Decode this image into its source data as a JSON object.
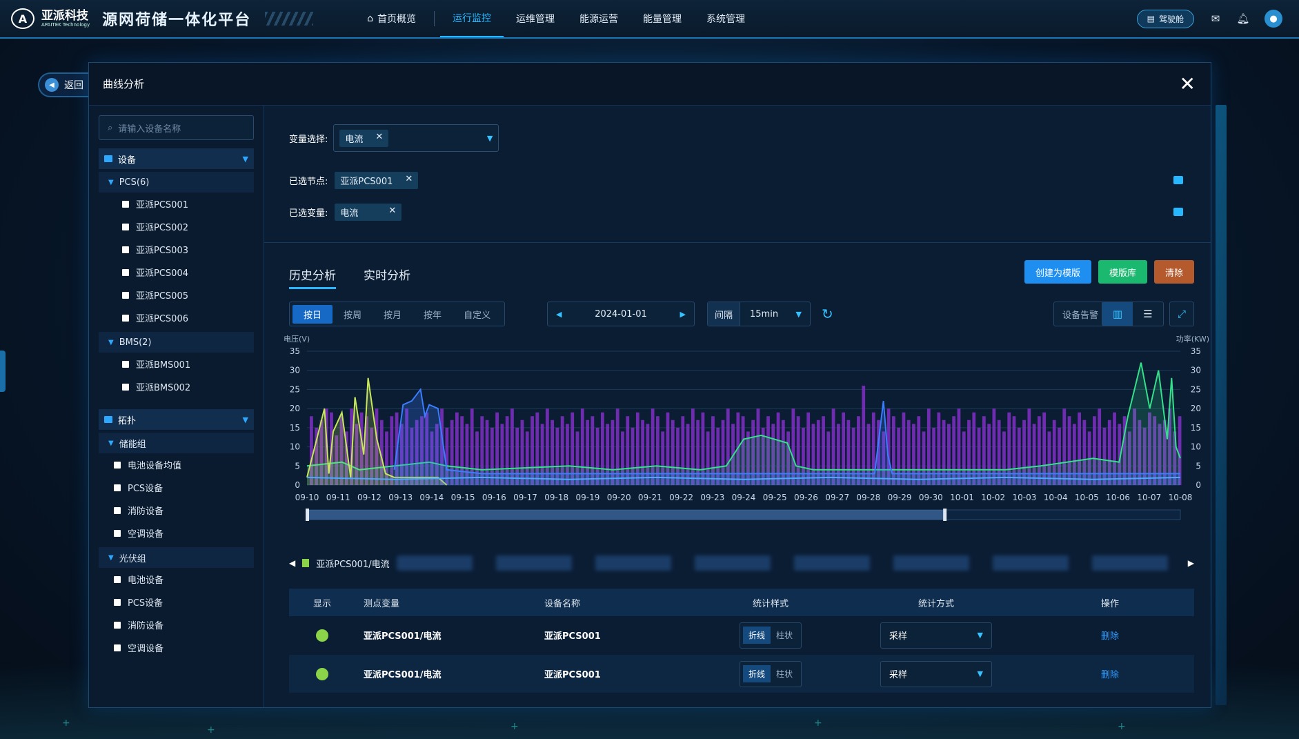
{
  "header": {
    "logo_text": "亚派科技",
    "logo_sub": "APAITEK Technology",
    "app_title": "源网荷储一体化平台",
    "nav": [
      "首页概览",
      "运行监控",
      "运维管理",
      "能源运营",
      "能量管理",
      "系统管理"
    ],
    "nav_active": "运行监控",
    "cockpit_label": "驾驶舱"
  },
  "back_label": "返回",
  "modal": {
    "title": "曲线分析",
    "search_placeholder": "请输入设备名称",
    "tree": {
      "devices_label": "设备",
      "pcs_group": "PCS(6)",
      "pcs_items": [
        "亚派PCS001",
        "亚派PCS002",
        "亚派PCS003",
        "亚派PCS004",
        "亚派PCS005",
        "亚派PCS006"
      ],
      "bms_group": "BMS(2)",
      "bms_items": [
        "亚派BMS001",
        "亚派BMS002"
      ],
      "topology_label": "拓扑",
      "storage_group": "储能组",
      "storage_items": [
        "电池设备均值",
        "PCS设备",
        "消防设备",
        "空调设备"
      ],
      "pv_group": "光伏组",
      "pv_items": [
        "电池设备",
        "PCS设备",
        "消防设备",
        "空调设备"
      ]
    },
    "var_select_label": "变量选择:",
    "var_select_chip": "电流",
    "selected_nodes_label": "已选节点:",
    "selected_node": "亚派PCS001",
    "selected_vars_label": "已选变量:",
    "selected_var": "电流",
    "tabs": [
      "历史分析",
      "实时分析"
    ],
    "buttons": {
      "create_template": "创建为模版",
      "template_lib": "模版库",
      "clear": "清除"
    },
    "period_options": [
      "按日",
      "按周",
      "按月",
      "按年",
      "自定义"
    ],
    "period_active": "按日",
    "date": "2024-01-01",
    "interval_label": "间隔",
    "interval_value": "15min",
    "alarm_label": "设备告警",
    "legend_first": "亚派PCS001/电流",
    "table": {
      "headers": [
        "显示",
        "测点变量",
        "设备名称",
        "统计样式",
        "统计方式",
        "操作"
      ],
      "rows": [
        {
          "var": "亚派PCS001/电流",
          "device": "亚派PCS001",
          "style_line": "折线",
          "style_bar": "柱状",
          "method": "采样",
          "action": "删除"
        },
        {
          "var": "亚派PCS001/电流",
          "device": "亚派PCS001",
          "style_line": "折线",
          "style_bar": "柱状",
          "method": "采样",
          "action": "删除"
        }
      ]
    }
  },
  "chart_data": {
    "type": "bar",
    "ylabel_left": "电压(V)",
    "ylabel_right": "功率(KW)",
    "ylim": [
      0,
      35
    ],
    "yticks": [
      0,
      5,
      10,
      15,
      20,
      25,
      30,
      35
    ],
    "categories": [
      "09-10",
      "09-11",
      "09-12",
      "09-13",
      "09-14",
      "09-15",
      "09-16",
      "09-17",
      "09-18",
      "09-19",
      "09-20",
      "09-21",
      "09-22",
      "09-23",
      "09-24",
      "09-25",
      "09-26",
      "09-27",
      "09-28",
      "09-29",
      "09-30",
      "10-01",
      "10-02",
      "10-03",
      "10-04",
      "10-05",
      "10-06",
      "10-07",
      "10-08"
    ],
    "bar_values": [
      18,
      15,
      17,
      20,
      19,
      13,
      18,
      14,
      20,
      16,
      19,
      18,
      15,
      20,
      17,
      14,
      18,
      19,
      16,
      20,
      15,
      17,
      18,
      19,
      14,
      16,
      20,
      15,
      17,
      19,
      18,
      16,
      20,
      14,
      18,
      17,
      15,
      19,
      16,
      18,
      20,
      15,
      17,
      14,
      18,
      19,
      16,
      20,
      17,
      15,
      18,
      16,
      19,
      14,
      20,
      17,
      18,
      15,
      19,
      16,
      17,
      20,
      14,
      18,
      15,
      19,
      17,
      16,
      20,
      18,
      14,
      19,
      17,
      15,
      18,
      16,
      20,
      17,
      19,
      14,
      18,
      15,
      17,
      20,
      16,
      19,
      18,
      14,
      17,
      20,
      15,
      18,
      16,
      19,
      17,
      14,
      20,
      18,
      15,
      19,
      16,
      17,
      18,
      14,
      20,
      16,
      19,
      17,
      15,
      18,
      26,
      16,
      19,
      17,
      14,
      20,
      18,
      15,
      19,
      17,
      16,
      18,
      14,
      20,
      15,
      19,
      17,
      16,
      18,
      20,
      14,
      17,
      19,
      15,
      18,
      16,
      20,
      17,
      14,
      19,
      18,
      15,
      17,
      20,
      16,
      18,
      19,
      14,
      17,
      15,
      20,
      18,
      16,
      19,
      17,
      14,
      18,
      20,
      15,
      17,
      19,
      16,
      18,
      14,
      20,
      17,
      15,
      19,
      18,
      16,
      17,
      20,
      14,
      18
    ],
    "series": [
      {
        "name": "green",
        "color": "#35e08a"
      },
      {
        "name": "yellow",
        "color": "#c8e65a"
      },
      {
        "name": "blue",
        "color": "#3a7dff"
      },
      {
        "name": "lightblue",
        "color": "#4aa8ff"
      }
    ]
  }
}
